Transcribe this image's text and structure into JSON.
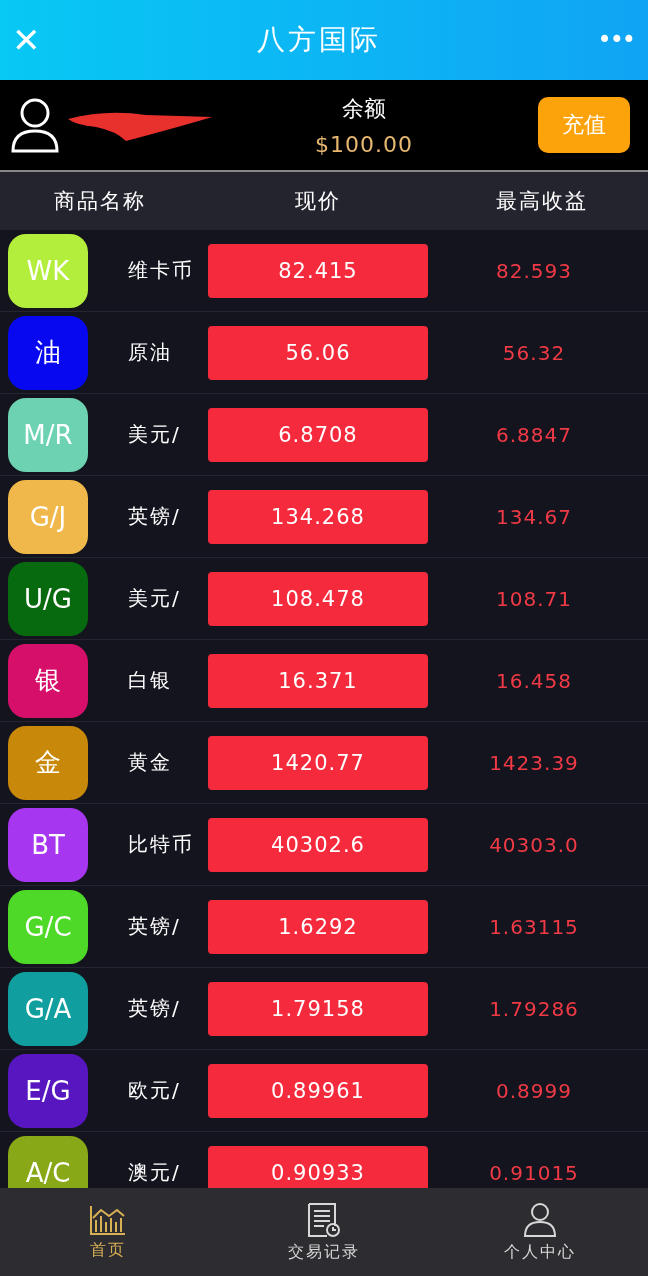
{
  "header": {
    "close": "✕",
    "title": "八方国际",
    "more": "•••"
  },
  "account": {
    "balance_label": "余额",
    "balance": "$100.00",
    "recharge_button": "充值"
  },
  "table": {
    "columns": [
      "商品名称",
      "现价",
      "最高收益"
    ],
    "rows": [
      {
        "code": "WK",
        "color": "#b4ee3c",
        "name": "维卡币",
        "price": "82.415",
        "high": "82.593"
      },
      {
        "code": "油",
        "color": "#0808f0",
        "name": "原油",
        "price": "56.06",
        "high": "56.32"
      },
      {
        "code": "M/R",
        "color": "#6cd2b2",
        "name": "美元/",
        "price": "6.8708",
        "high": "6.8847"
      },
      {
        "code": "G/J",
        "color": "#f0b84a",
        "name": "英镑/",
        "price": "134.268",
        "high": "134.67"
      },
      {
        "code": "U/G",
        "color": "#086a0e",
        "name": "美元/",
        "price": "108.478",
        "high": "108.71"
      },
      {
        "code": "银",
        "color": "#d6106a",
        "name": "白银",
        "price": "16.371",
        "high": "16.458"
      },
      {
        "code": "金",
        "color": "#c8880a",
        "name": "黄金",
        "price": "1420.77",
        "high": "1423.39"
      },
      {
        "code": "BT",
        "color": "#a636f0",
        "name": "比特币",
        "price": "40302.6",
        "high": "40303.0"
      },
      {
        "code": "G/C",
        "color": "#4ed828",
        "name": "英镑/",
        "price": "1.6292",
        "high": "1.63115"
      },
      {
        "code": "G/A",
        "color": "#109e9e",
        "name": "英镑/",
        "price": "1.79158",
        "high": "1.79286"
      },
      {
        "code": "E/G",
        "color": "#5816c0",
        "name": "欧元/",
        "price": "0.89961",
        "high": "0.8999"
      },
      {
        "code": "A/C",
        "color": "#88a818",
        "name": "澳元/",
        "price": "0.90933",
        "high": "0.91015"
      }
    ]
  },
  "tab_bar": [
    {
      "kind": "chart",
      "label": "首页",
      "selected": true
    },
    {
      "kind": "records",
      "label": "交易记录",
      "selected": false
    },
    {
      "kind": "person",
      "label": "个人中心",
      "selected": false
    }
  ]
}
